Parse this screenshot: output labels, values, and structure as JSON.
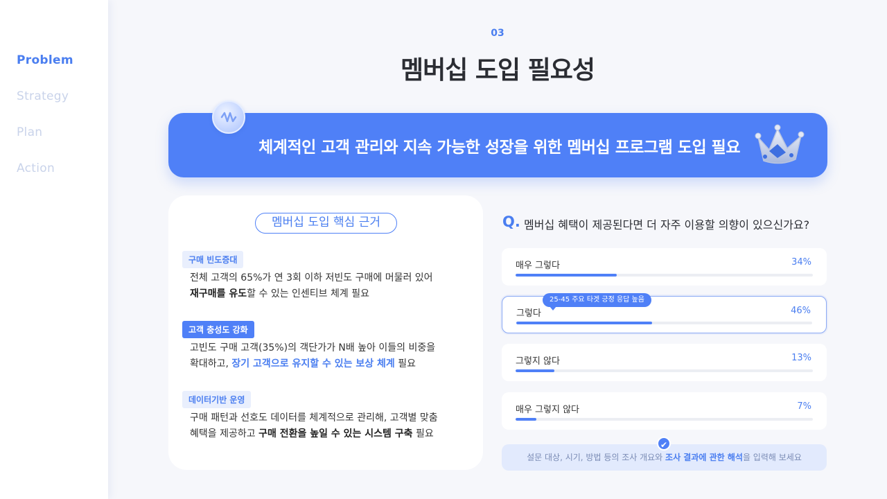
{
  "sidebar": {
    "items": [
      {
        "label": "Problem",
        "active": true
      },
      {
        "label": "Strategy",
        "active": false
      },
      {
        "label": "Plan",
        "active": false
      },
      {
        "label": "Action",
        "active": false
      }
    ]
  },
  "header": {
    "section_number": "03",
    "title": "멤버십 도입 필요성"
  },
  "banner": {
    "text": "체계적인 고객 관리와 지속 가능한 성장을 위한 멤버십 프로그램 도입 필요"
  },
  "left_card": {
    "title": "멤버십 도입 핵심 근거",
    "sections": [
      {
        "tag": "구매 빈도증대",
        "line1": "전체 고객의 65%가 연 3회 이하 저빈도 구매에 머물러 있어",
        "line2_bold": "재구매를 유도",
        "line2_rest": "할 수 있는 인센티브 체계 필요"
      },
      {
        "tag": "고객 충성도 강화",
        "line1": "고빈도 구매 고객(35%)의 객단가가 N배 높아 이들의 비중을",
        "line2_pre": "확대하고, ",
        "line2_highlight": "장기 고객으로 유지할 수 있는 보상 체계",
        "line2_post": " 필요"
      },
      {
        "tag": "데이터기반 운영",
        "line1": "구매 패턴과 선호도 데이터를 체계적으로 관리해, 고객별 맞춤",
        "line2_pre": "혜택을 제공하고 ",
        "line2_bold": "구매 전환을 높일 수 있는 시스템 구축",
        "line2_post": " 필요"
      }
    ]
  },
  "survey": {
    "q_mark": "Q.",
    "question": "멤버십 혜택이 제공된다면 더 자주 이용할 의향이 있으신가요?",
    "options": [
      {
        "label": "매우 그렇다",
        "percent_text": "34%",
        "value": 0.34
      },
      {
        "label": "그렇다",
        "percent_text": "46%",
        "value": 0.46
      },
      {
        "label": "그렇지 않다",
        "percent_text": "13%",
        "value": 0.13
      },
      {
        "label": "매우 그렇지 않다",
        "percent_text": "7%",
        "value": 0.07
      }
    ],
    "tooltip": "25-45 주요 타겟 긍정 응답 높음",
    "note_pre": "설문 대상, 시기, 방법 등의 조사 개요와 ",
    "note_bold": "조사 결과에 관한 해석",
    "note_post": "을 입력해 보세요"
  },
  "colors": {
    "accent": "#4f80f7",
    "sidebar_inactive": "#c9d3ea",
    "background": "#f6f7fb"
  },
  "icons": {
    "badge": "wave-badge-icon",
    "crown": "crown-icon",
    "check": "check-icon"
  }
}
